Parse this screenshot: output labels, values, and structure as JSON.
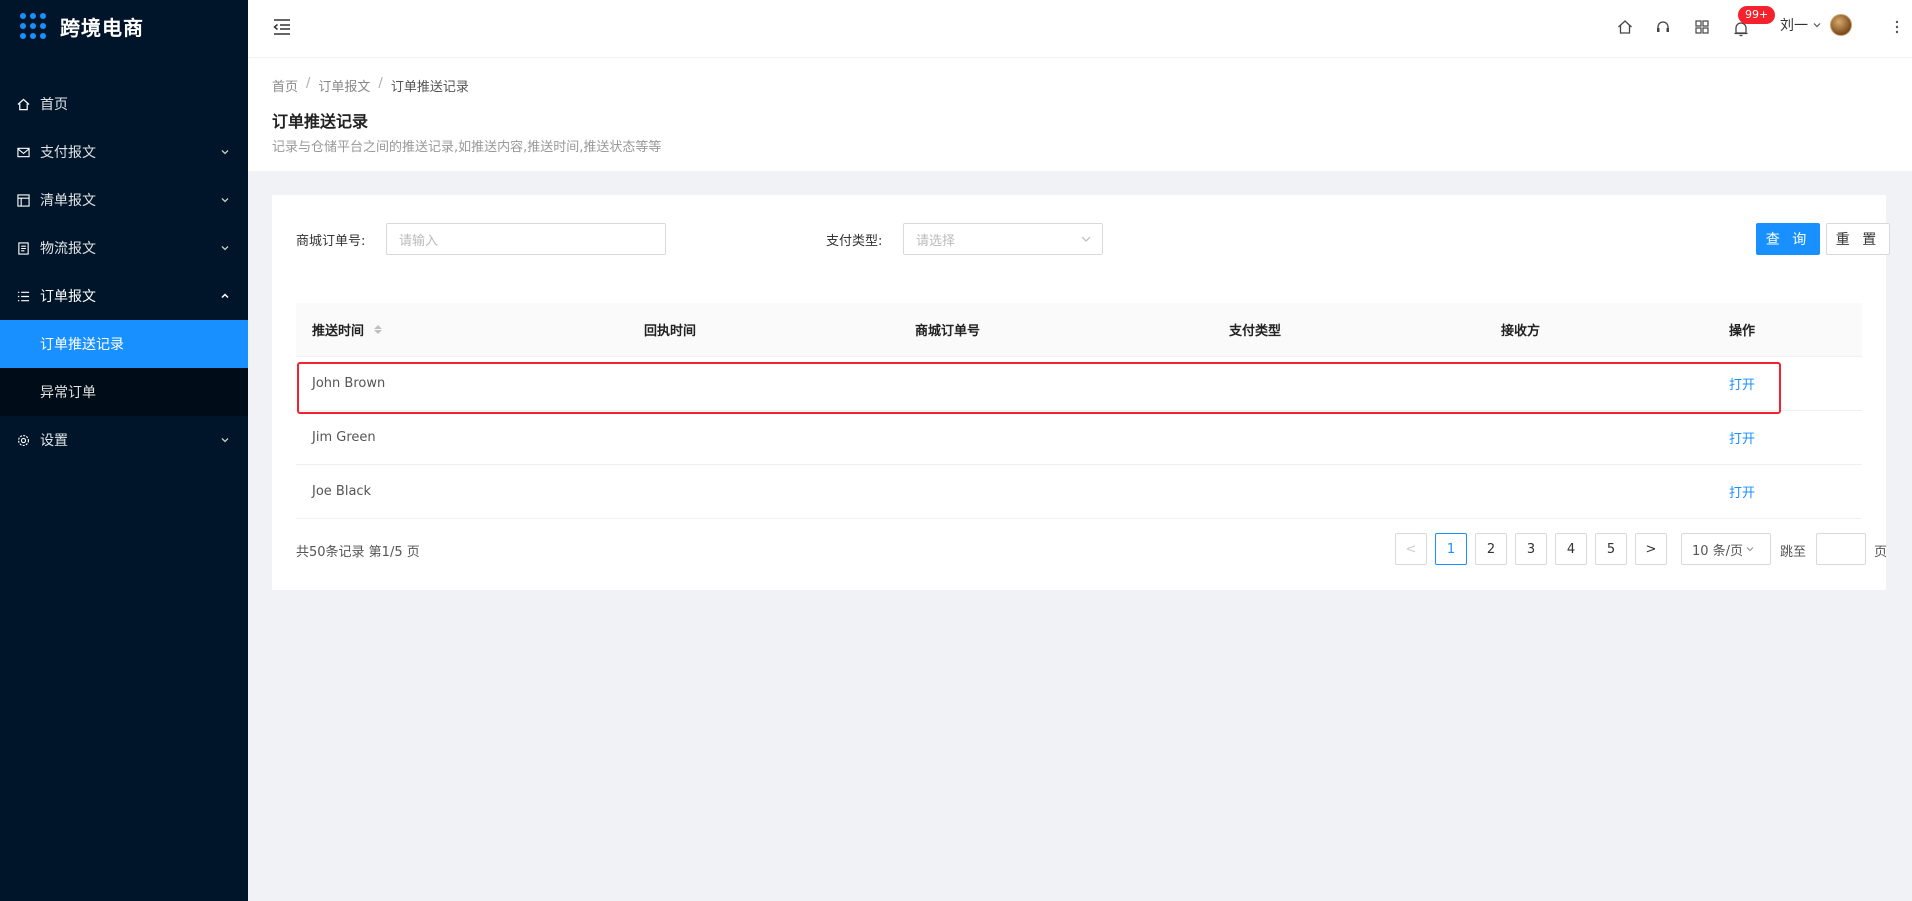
{
  "app": {
    "title": "跨境电商"
  },
  "sidebar": {
    "items": [
      {
        "label": "首页"
      },
      {
        "label": "支付报文"
      },
      {
        "label": "清单报文"
      },
      {
        "label": "物流报文"
      },
      {
        "label": "订单报文"
      },
      {
        "label": "设置"
      }
    ],
    "submenu": [
      {
        "label": "订单推送记录"
      },
      {
        "label": "异常订单"
      }
    ]
  },
  "header": {
    "badge": "99+",
    "user_name": "刘一"
  },
  "breadcrumb": [
    "首页",
    "订单报文",
    "订单推送记录"
  ],
  "page": {
    "title": "订单推送记录",
    "description": "记录与仓储平台之间的推送记录,如推送内容,推送时间,推送状态等等"
  },
  "search": {
    "order_label": "商城订单号:",
    "order_placeholder": "请输入",
    "pay_label": "支付类型:",
    "pay_placeholder": "请选择",
    "query_button": "查 询",
    "reset_button": "重 置"
  },
  "table": {
    "columns": [
      "推送时间",
      "回执时间",
      "商城订单号",
      "支付类型",
      "接收方",
      "操作"
    ],
    "rows": [
      {
        "push_time": "John Brown",
        "action": "打开"
      },
      {
        "push_time": "Jim Green",
        "action": "打开"
      },
      {
        "push_time": "Joe Black",
        "action": "打开"
      }
    ]
  },
  "pagination": {
    "total_text": "共50条记录 第1/5 页",
    "pages": [
      "1",
      "2",
      "3",
      "4",
      "5"
    ],
    "current": "1",
    "prev": "<",
    "next": ">",
    "page_size": "10 条/页",
    "jump_label": "跳至",
    "page_unit": "页"
  },
  "colors": {
    "primary": "#1890ff",
    "sidebar_bg": "#001529",
    "highlight": "#f5222d"
  }
}
